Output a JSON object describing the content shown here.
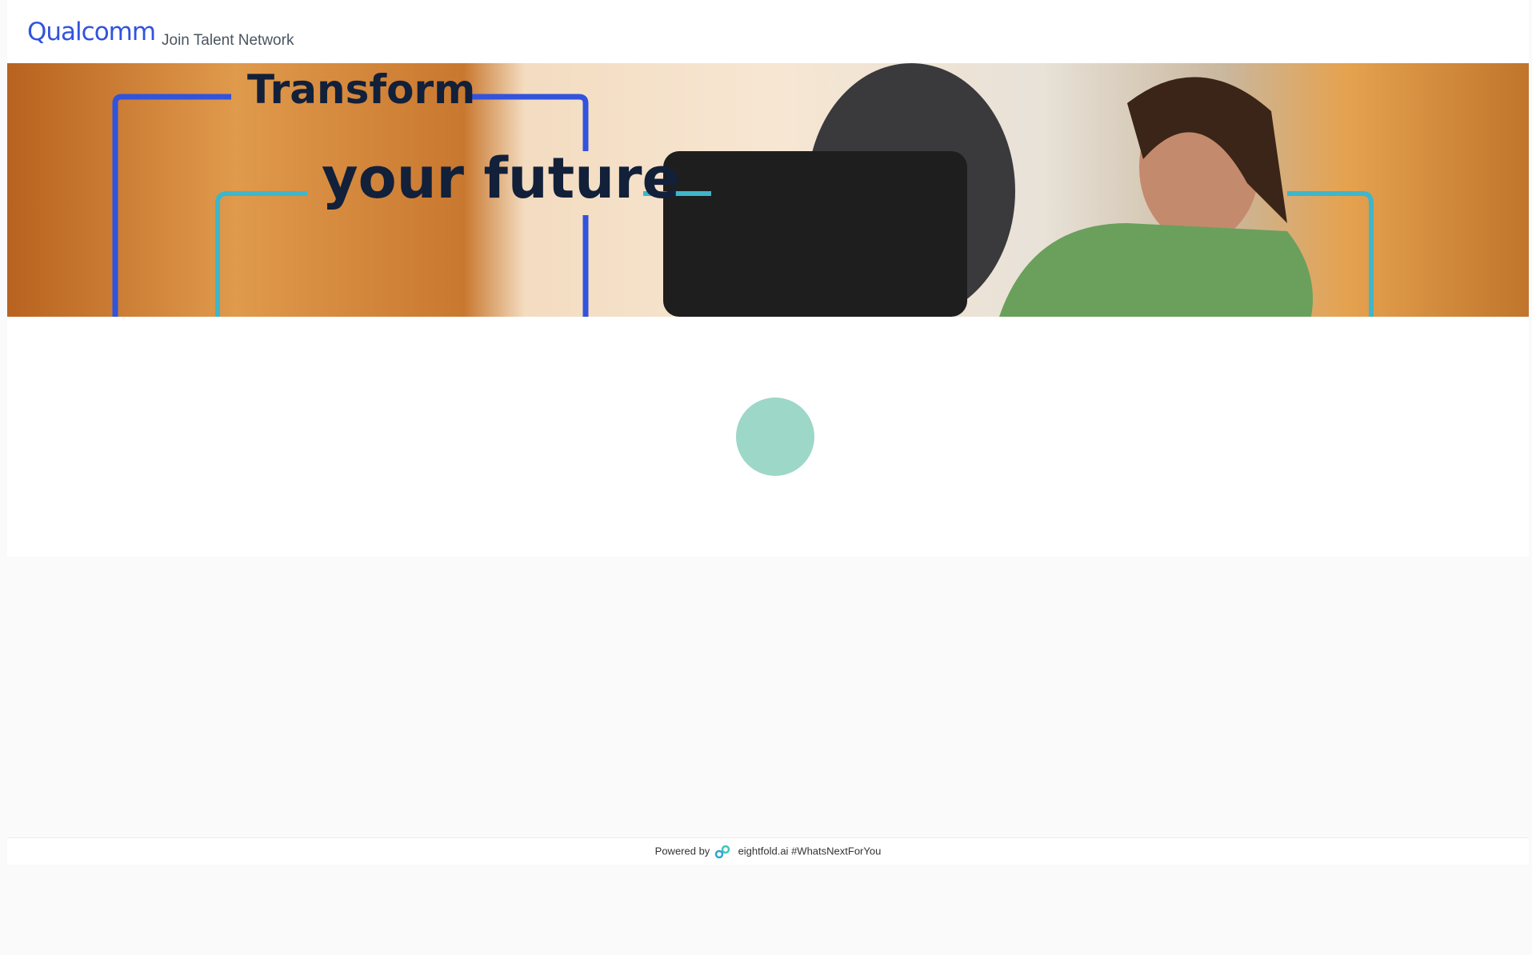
{
  "header": {
    "logo_text": "Qualcomm",
    "subtitle": "Join Talent Network"
  },
  "banner": {
    "line1": "Transform",
    "line2": "your future"
  },
  "loading": {
    "state": "loading"
  },
  "footer": {
    "powered_by": "Powered by",
    "brand": "eightfold.ai",
    "hashtag": "#WhatsNextForYou"
  },
  "colors": {
    "brand_blue": "#3253dc",
    "spinner": "#9dd7c8",
    "accent_teal": "#3fb6c9"
  }
}
